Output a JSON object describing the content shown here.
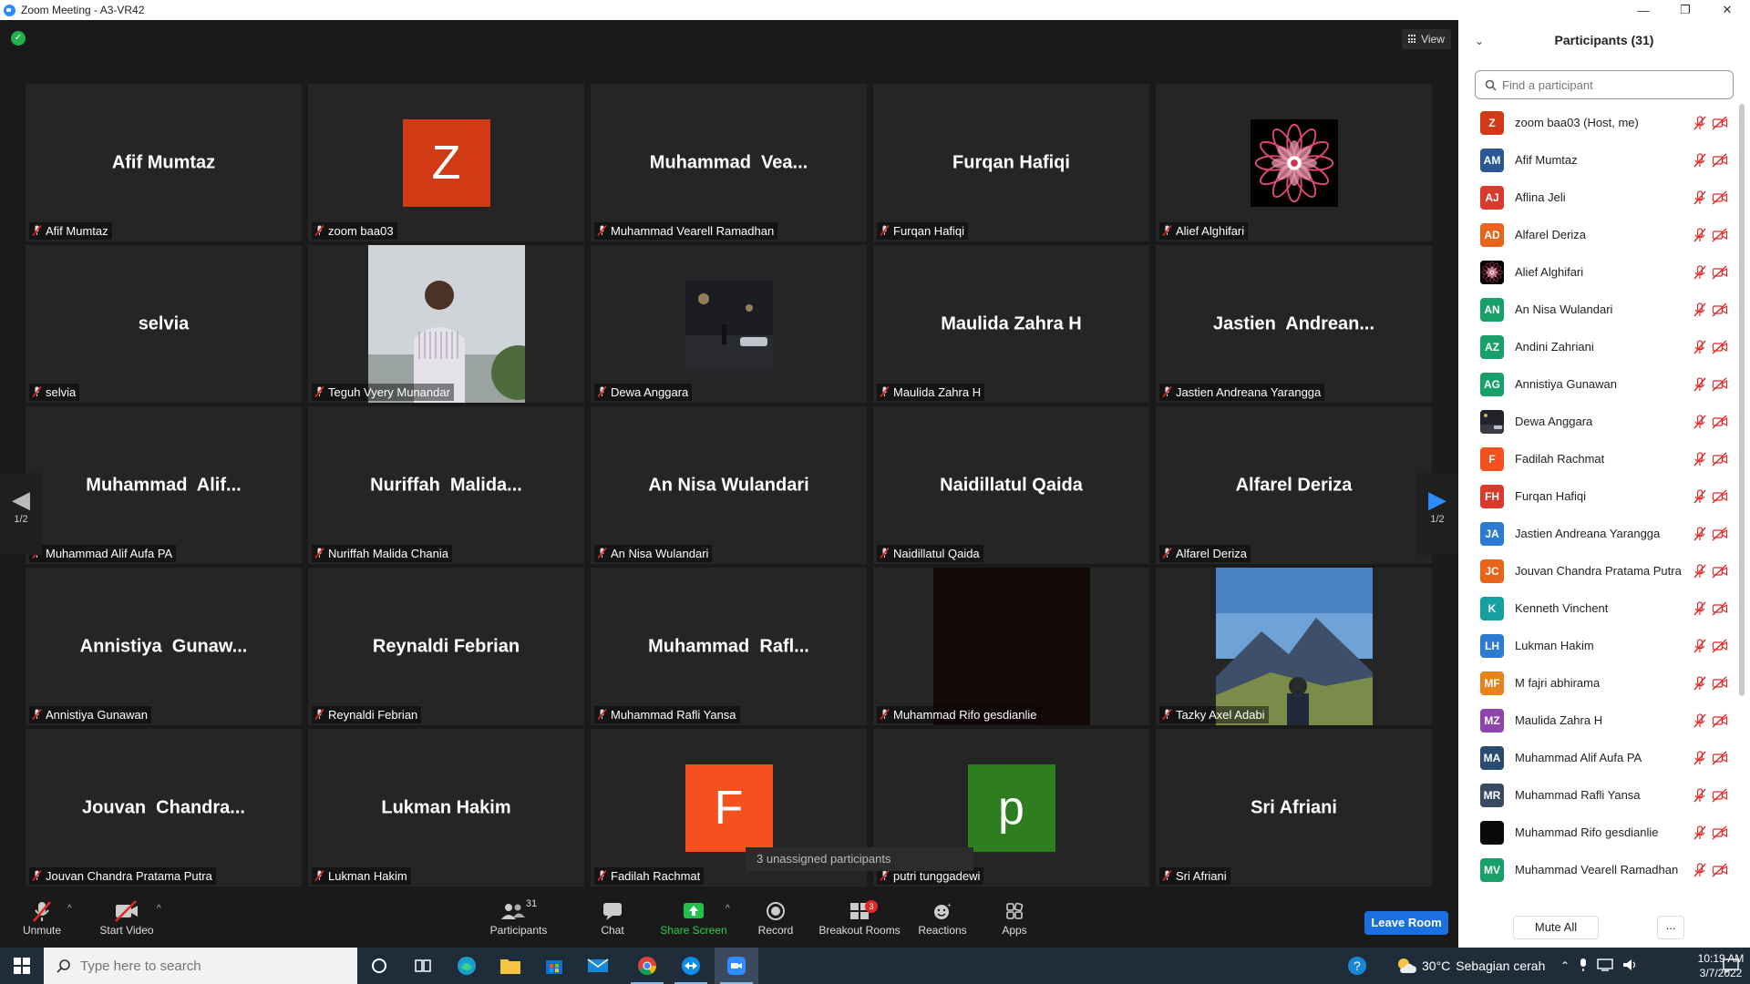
{
  "window": {
    "title": "Zoom Meeting - A3-VR42"
  },
  "meeting": {
    "view_label": "View",
    "page_indicator": "1/2",
    "unassigned_tooltip": "3 unassigned participants",
    "tiles": [
      {
        "big": "Afif Mumtaz",
        "label": "Afif Mumtaz",
        "kind": "name"
      },
      {
        "big": "Z",
        "label": "zoom baa03",
        "kind": "avatar",
        "color": "#d03b16"
      },
      {
        "big": "Muhammad  Vea...",
        "label": "Muhammad Vearell Ramadhan",
        "kind": "name"
      },
      {
        "big": "Furqan Hafiqi",
        "label": "Furqan Hafiqi",
        "kind": "name"
      },
      {
        "big": "",
        "label": "Alief Alghifari",
        "kind": "mandala"
      },
      {
        "big": "selvia",
        "label": "selvia",
        "kind": "name"
      },
      {
        "big": "",
        "label": "Teguh Vyery Munandar",
        "kind": "video-person"
      },
      {
        "big": "",
        "label": "Dewa Anggara",
        "kind": "photo-night"
      },
      {
        "big": "Maulida Zahra H",
        "label": "Maulida Zahra H",
        "kind": "name"
      },
      {
        "big": "Jastien  Andrean...",
        "label": "Jastien Andreana Yarangga",
        "kind": "name"
      },
      {
        "big": "Muhammad  Alif...",
        "label": "Muhammad Alif Aufa PA",
        "kind": "name"
      },
      {
        "big": "Nuriffah  Malida...",
        "label": "Nuriffah Malida Chania",
        "kind": "name"
      },
      {
        "big": "An Nisa Wulandari",
        "label": "An Nisa Wulandari",
        "kind": "name"
      },
      {
        "big": "Naidillatul Qaida",
        "label": "Naidillatul Qaida",
        "kind": "name"
      },
      {
        "big": "Alfarel Deriza",
        "label": "Alfarel Deriza",
        "kind": "name"
      },
      {
        "big": "Annistiya  Gunaw...",
        "label": "Annistiya Gunawan",
        "kind": "name"
      },
      {
        "big": "Reynaldi Febrian",
        "label": "Reynaldi Febrian",
        "kind": "name"
      },
      {
        "big": "Muhammad  Rafl...",
        "label": "Muhammad Rafli Yansa",
        "kind": "name"
      },
      {
        "big": "",
        "label": "Muhammad Rifo gesdianlie",
        "kind": "video-dark"
      },
      {
        "big": "",
        "label": "Tazky Axel Adabi",
        "kind": "video-mountain"
      },
      {
        "big": "Jouvan  Chandra...",
        "label": "Jouvan Chandra Pratama Putra",
        "kind": "name"
      },
      {
        "big": "Lukman Hakim",
        "label": "Lukman Hakim",
        "kind": "name"
      },
      {
        "big": "F",
        "label": "Fadilah Rachmat",
        "kind": "avatar",
        "color": "#f4511e"
      },
      {
        "big": "p",
        "label": "putri tunggadewi",
        "kind": "avatar",
        "color": "#2e7d1e"
      },
      {
        "big": "Sri Afriani",
        "label": "Sri Afriani",
        "kind": "name"
      }
    ]
  },
  "toolbar": {
    "unmute": "Unmute",
    "start_video": "Start Video",
    "participants": "Participants",
    "participants_count": "31",
    "chat": "Chat",
    "share_screen": "Share Screen",
    "record": "Record",
    "breakout_rooms": "Breakout Rooms",
    "breakout_badge": "3",
    "reactions": "Reactions",
    "apps": "Apps",
    "leave": "Leave Room"
  },
  "panel": {
    "title": "Participants (31)",
    "search_placeholder": "Find a participant",
    "mute_all": "Mute All",
    "more": "...",
    "participants": [
      {
        "initials": "Z",
        "name": "zoom baa03 (Host, me)",
        "color": "#d03b16"
      },
      {
        "initials": "AM",
        "name": "Afif Mumtaz",
        "color": "#2b5797"
      },
      {
        "initials": "AJ",
        "name": "Aflina Jeli",
        "color": "#d83b2e"
      },
      {
        "initials": "AD",
        "name": "Alfarel Deriza",
        "color": "#e8641b"
      },
      {
        "initials": "",
        "name": "Alief Alghifari",
        "color": "#5a1020",
        "img": "mandala"
      },
      {
        "initials": "AN",
        "name": "An Nisa Wulandari",
        "color": "#18a06b"
      },
      {
        "initials": "AZ",
        "name": "Andini Zahriani",
        "color": "#18a06b"
      },
      {
        "initials": "AG",
        "name": "Annistiya Gunawan",
        "color": "#18a06b"
      },
      {
        "initials": "",
        "name": "Dewa Anggara",
        "color": "#333",
        "img": "night"
      },
      {
        "initials": "F",
        "name": "Fadilah Rachmat",
        "color": "#f4511e"
      },
      {
        "initials": "FH",
        "name": "Furqan Hafiqi",
        "color": "#d83b2e"
      },
      {
        "initials": "JA",
        "name": "Jastien Andreana Yarangga",
        "color": "#2b7bd3"
      },
      {
        "initials": "JC",
        "name": "Jouvan Chandra Pratama Putra",
        "color": "#e8641b"
      },
      {
        "initials": "K",
        "name": "Kenneth Vinchent",
        "color": "#18a0a0"
      },
      {
        "initials": "LH",
        "name": "Lukman Hakim",
        "color": "#2b7bd3"
      },
      {
        "initials": "MF",
        "name": "M fajri abhirama",
        "color": "#e8821b"
      },
      {
        "initials": "MZ",
        "name": "Maulida Zahra H",
        "color": "#8e44ad"
      },
      {
        "initials": "MA",
        "name": "Muhammad Alif Aufa PA",
        "color": "#2b4a6f"
      },
      {
        "initials": "MR",
        "name": "Muhammad Rafli Yansa",
        "color": "#3b4a63"
      },
      {
        "initials": "",
        "name": "Muhammad Rifo gesdianlie",
        "color": "#0a0a0a"
      },
      {
        "initials": "MV",
        "name": "Muhammad Vearell Ramadhan",
        "color": "#18a06b"
      }
    ]
  },
  "taskbar": {
    "search_placeholder": "Type here to search",
    "temperature": "30°C",
    "weather": "Sebagian cerah",
    "time": "10:19 AM",
    "date": "3/7/2022"
  }
}
